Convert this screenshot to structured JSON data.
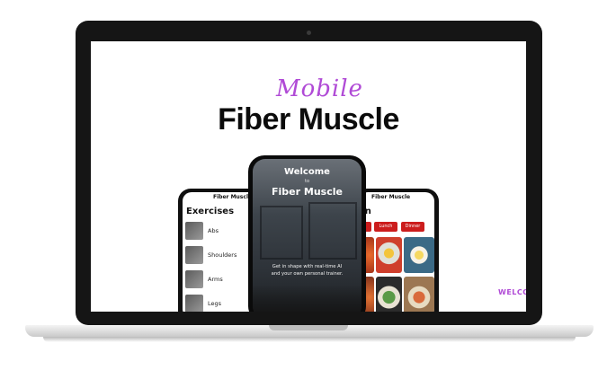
{
  "hero": {
    "script_title": "Mobile",
    "main_title": "Fiber Muscle",
    "edge_text": "WELCOM"
  },
  "phone_left": {
    "brand": "Fiber Muscle",
    "heading": "Exercises",
    "items": [
      {
        "label": "Abs"
      },
      {
        "label": "Shoulders"
      },
      {
        "label": "Arms"
      },
      {
        "label": "Legs"
      }
    ]
  },
  "phone_center": {
    "welcome": "Welcome",
    "to": "to",
    "brand": "Fiber Muscle",
    "tagline_1": "Get in shape with real-time AI",
    "tagline_2": "and your own personal trainer."
  },
  "phone_right": {
    "brand": "Fiber Muscle",
    "heading": "an",
    "meals": [
      "",
      "Lunch",
      "Dinner"
    ]
  },
  "colors": {
    "accent": "#b04ad6",
    "button_red": "#cc1d1d",
    "bezel": "#151515"
  }
}
